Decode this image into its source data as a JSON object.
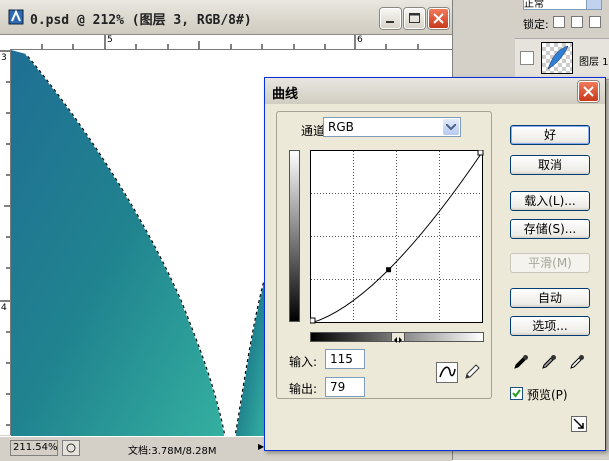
{
  "document": {
    "title": "0.psd @ 212% (图层 3, RGB/8#)",
    "ruler": {
      "h_labels": [
        "5",
        "6"
      ],
      "v_labels": [
        "3",
        "4"
      ]
    },
    "status": {
      "zoom": "211.54%",
      "doc_size": "文档:3.78M/8.28M",
      "arrow": "▶"
    }
  },
  "layers_panel": {
    "blend_mode": "正常",
    "lock_label": "锁定:",
    "layer_name": "图层 1"
  },
  "curves_dialog": {
    "title": "曲线",
    "channel_label": "通道(C):",
    "channel_value": "RGB",
    "input_label": "输入:",
    "input_value": "115",
    "output_label": "输出:",
    "output_value": "79",
    "buttons": {
      "ok": "好",
      "cancel": "取消",
      "load": "载入(L)...",
      "save": "存储(S)...",
      "smooth": "平滑(M)",
      "auto": "自动",
      "options": "选项..."
    },
    "preview_label": "预览(P)",
    "preview_checked": true,
    "curve": {
      "control_point": {
        "input": 115,
        "output": 79
      },
      "range": [
        0,
        255
      ]
    }
  },
  "colors": {
    "xp_title_blue": "#0831d9",
    "close_red": "#c8391b",
    "teal_dark": "#1f7391",
    "teal_light": "#2fa89b"
  }
}
